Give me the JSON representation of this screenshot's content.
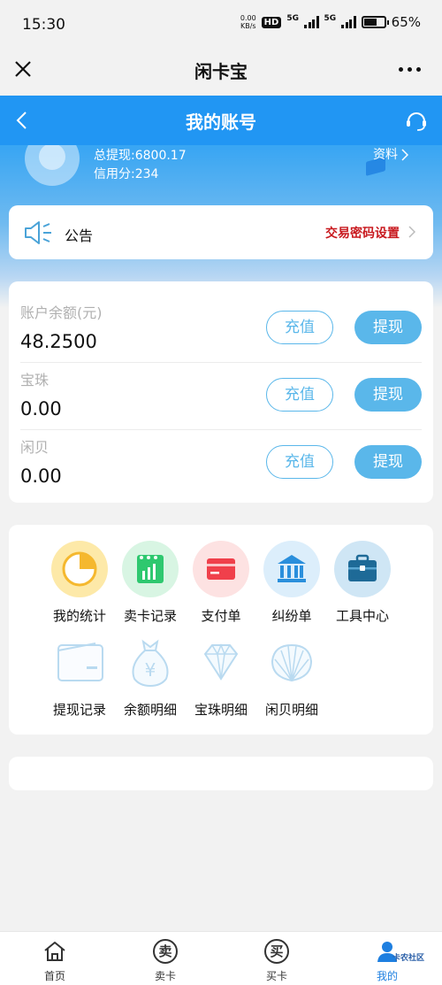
{
  "status": {
    "time": "15:30",
    "net_speed_top": "0.00",
    "net_speed_bottom": "KB/s",
    "hd": "HD",
    "gen1": "5G",
    "gen2": "5G",
    "battery": "65%"
  },
  "topbar": {
    "title": "闲卡宝"
  },
  "header": {
    "title": "我的账号",
    "total_withdraw": "总提现:6800.17",
    "credit": "信用分:234",
    "profile": "资料"
  },
  "notice": {
    "label": "公告",
    "link": "交易密码设置"
  },
  "balances": [
    {
      "label": "账户余额(元)",
      "value": "48.2500",
      "recharge": "充值",
      "withdraw": "提现"
    },
    {
      "label": "宝珠",
      "value": "0.00",
      "recharge": "充值",
      "withdraw": "提现"
    },
    {
      "label": "闲贝",
      "value": "0.00",
      "recharge": "充值",
      "withdraw": "提现"
    }
  ],
  "tools": [
    {
      "label": "我的统计",
      "icon": "pie-chart-icon",
      "color": "#fde9a8"
    },
    {
      "label": "卖卡记录",
      "icon": "calendar-chart-icon",
      "color": "#d8f5e3"
    },
    {
      "label": "支付单",
      "icon": "card-icon",
      "color": "#fde2e2"
    },
    {
      "label": "纠纷单",
      "icon": "bank-icon",
      "color": "#dceefb"
    },
    {
      "label": "工具中心",
      "icon": "toolbox-icon",
      "color": "#cfe6f5"
    },
    {
      "label": "提现记录",
      "icon": "wallet-icon"
    },
    {
      "label": "余额明细",
      "icon": "money-bag-icon"
    },
    {
      "label": "宝珠明细",
      "icon": "diamond-icon"
    },
    {
      "label": "闲贝明细",
      "icon": "shell-icon"
    }
  ],
  "tabs": [
    {
      "label": "首页",
      "glyph": ""
    },
    {
      "label": "卖卡",
      "glyph": "卖"
    },
    {
      "label": "买卡",
      "glyph": "买"
    },
    {
      "label": "我的",
      "glyph": ""
    }
  ],
  "watermark": "卡农社区"
}
